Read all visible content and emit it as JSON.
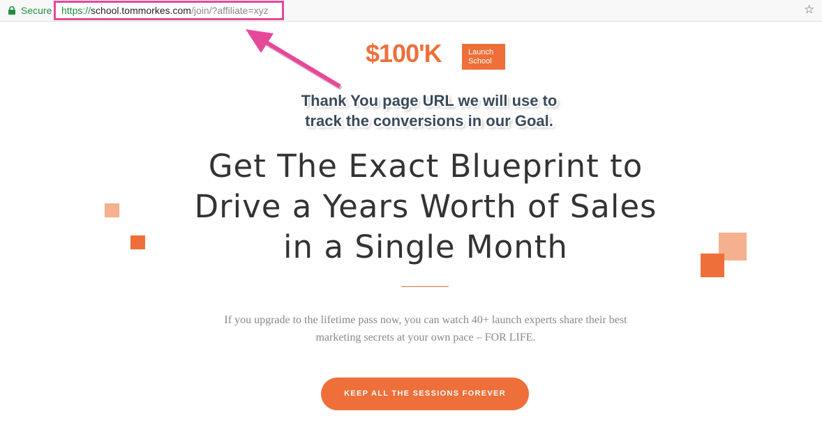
{
  "browser": {
    "secure_label": "Secure",
    "url_scheme": "https://",
    "url_host": "school.tommorkes.com",
    "url_path": "/join/?affiliate=xyz",
    "star_icon": "☆"
  },
  "logo": {
    "text": "$100'K",
    "box_line1": "Launch",
    "box_line2": "School"
  },
  "annotation": {
    "line1": "Thank You page URL we will use to",
    "line2": "track the conversions in our Goal."
  },
  "headline": {
    "line1": "Get The Exact Blueprint to",
    "line2": "Drive a Years Worth of Sales",
    "line3": "in a Single Month"
  },
  "subtext": {
    "line1": "If you upgrade to the lifetime pass now, you can watch 40+ launch experts share their best",
    "line2": "marketing secrets at your own pace – FOR LIFE."
  },
  "cta": {
    "label": "KEEP ALL THE SESSIONS FOREVER"
  },
  "colors": {
    "accent": "#ee6f39",
    "accent_light": "#f4b08f",
    "highlight": "#e6489a",
    "secure_green": "#1e8e3e"
  }
}
